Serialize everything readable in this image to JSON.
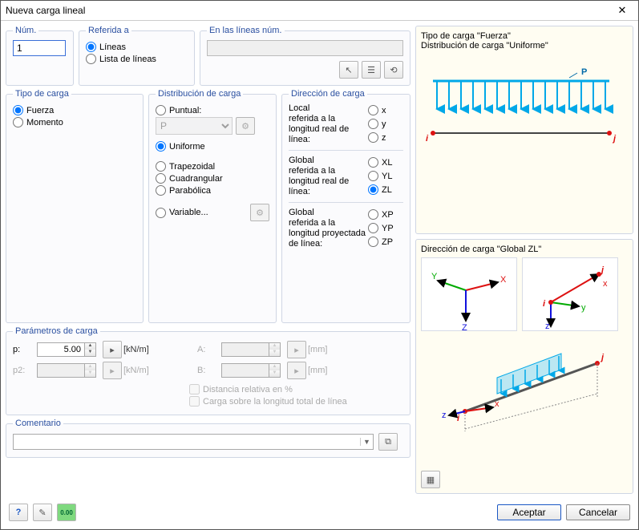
{
  "title": "Nueva carga lineal",
  "groups": {
    "num": "Núm.",
    "ref": "Referida a",
    "lines": "En las líneas núm.",
    "tipo": "Tipo de carga",
    "dist": "Distribución de carga",
    "dir": "Dirección de carga",
    "params": "Parámetros de carga",
    "comentario": "Comentario"
  },
  "num_value": "1",
  "ref": {
    "lineas": "Líneas",
    "lista": "Lista de líneas",
    "selected": "lineas"
  },
  "tipo": {
    "fuerza": "Fuerza",
    "momento": "Momento",
    "selected": "fuerza"
  },
  "dist": {
    "puntual": "Puntual:",
    "uniforme": "Uniforme",
    "trapezoidal": "Trapezoidal",
    "cuadrangular": "Cuadrangular",
    "parabolica": "Parabólica",
    "variable": "Variable...",
    "dropdown_value": "P",
    "selected": "uniforme"
  },
  "dir": {
    "local_label": "Local\nreferida a la longitud real de línea:",
    "global_real_label": "Global\nreferida a la longitud real de línea:",
    "global_proj_label": "Global\nreferida a la longitud proyectada de línea:",
    "opts_local": [
      "x",
      "y",
      "z"
    ],
    "opts_global_real": [
      "XL",
      "YL",
      "ZL"
    ],
    "opts_global_proj": [
      "XP",
      "YP",
      "ZP"
    ],
    "selected": "ZL"
  },
  "params": {
    "p_label": "p:",
    "p_value": "5.00",
    "p_unit": "[kN/m]",
    "p2_label": "p2:",
    "p2_value": "",
    "p2_unit": "[kN/m]",
    "A_label": "A:",
    "A_value": "",
    "A_unit": "[mm]",
    "B_label": "B:",
    "B_value": "",
    "B_unit": "[mm]",
    "relative": "Distancia relativa en %",
    "total": "Carga sobre la longitud total de línea"
  },
  "preview": {
    "top_title1": "Tipo de carga \"Fuerza\"",
    "top_title2": "Distribución de carga \"Uniforme\"",
    "arrow_label": "P",
    "i": "i",
    "j": "j",
    "bottom_title": "Dirección de carga \"Global ZL\"",
    "axes": {
      "x": "X",
      "y": "Y",
      "z": "Z",
      "xl": "x",
      "yl": "y",
      "zl": "z"
    }
  },
  "buttons": {
    "aceptar": "Aceptar",
    "cancelar": "Cancelar"
  },
  "icons": {
    "help": "?",
    "edit": "✎",
    "num": "0.00",
    "pick": "↖",
    "list": "☰",
    "undo": "⟲",
    "settings": "⚙",
    "copy": "⧉",
    "graph": "▦"
  }
}
